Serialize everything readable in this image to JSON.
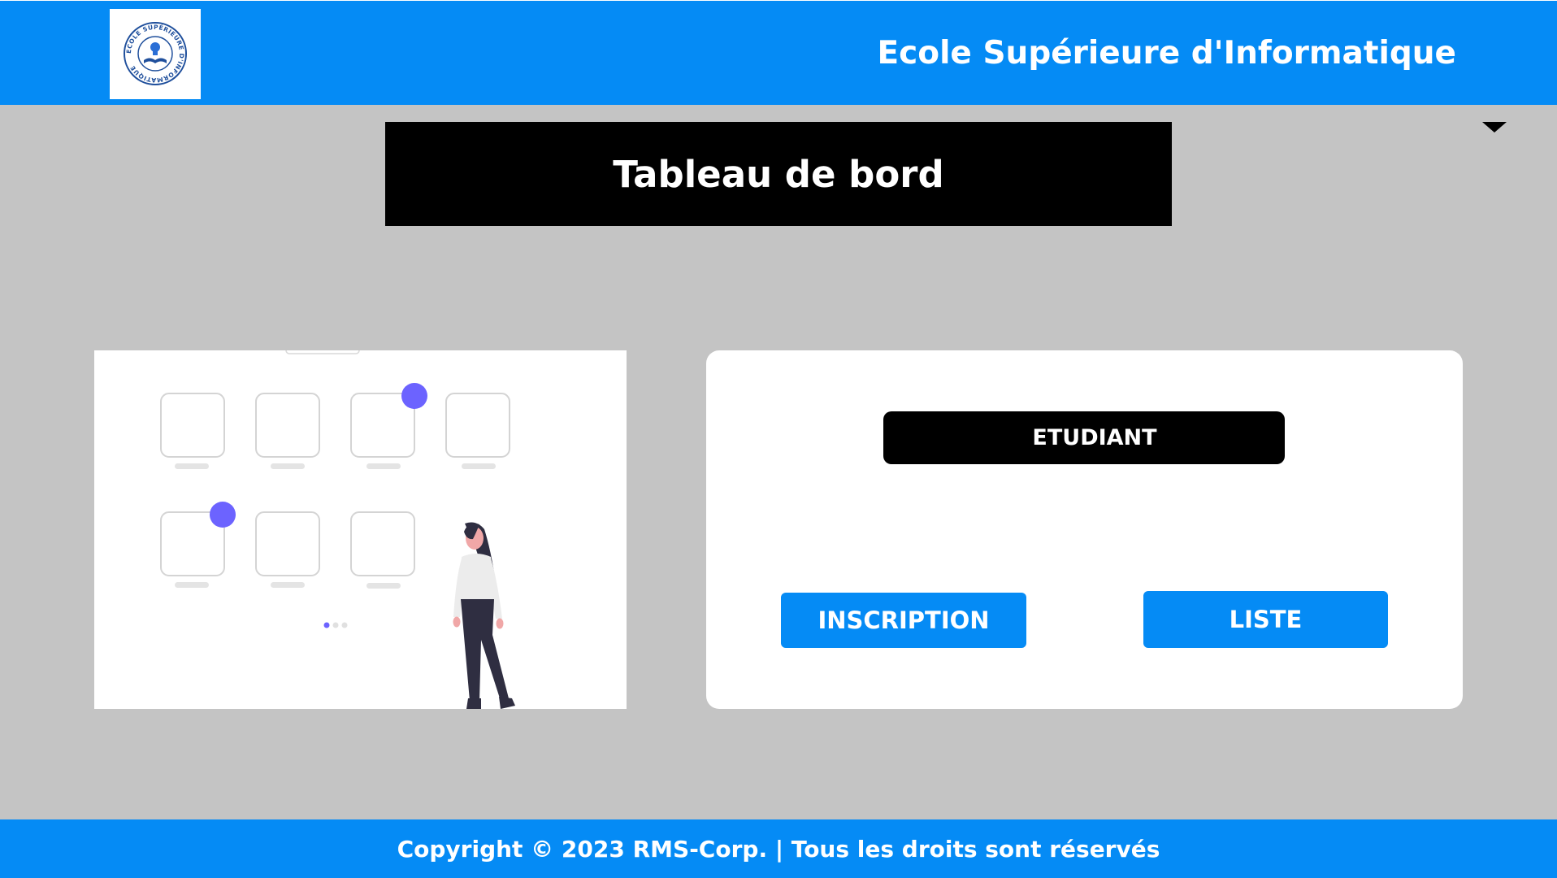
{
  "header": {
    "title": "Ecole Supérieure d'Informatique",
    "logo": {
      "icon": "school-seal-logo",
      "text": "ECOLE SUPÉRIEURE D'INFORMATIQUE"
    }
  },
  "menu": {
    "icon": "caret-down-icon"
  },
  "dashboard": {
    "title": "Tableau de bord"
  },
  "illustration": {
    "icon": "dashboard-illustration"
  },
  "card": {
    "label": "ETUDIANT",
    "buttons": {
      "inscription": "INSCRIPTION",
      "liste": "LISTE"
    }
  },
  "footer": {
    "text": "Copyright © 2023 RMS-Corp. | Tous les droits sont réservés"
  },
  "colors": {
    "primary": "#058bf5",
    "background": "#c4c4c4",
    "dark": "#000000",
    "accent": "#6c63ff"
  }
}
